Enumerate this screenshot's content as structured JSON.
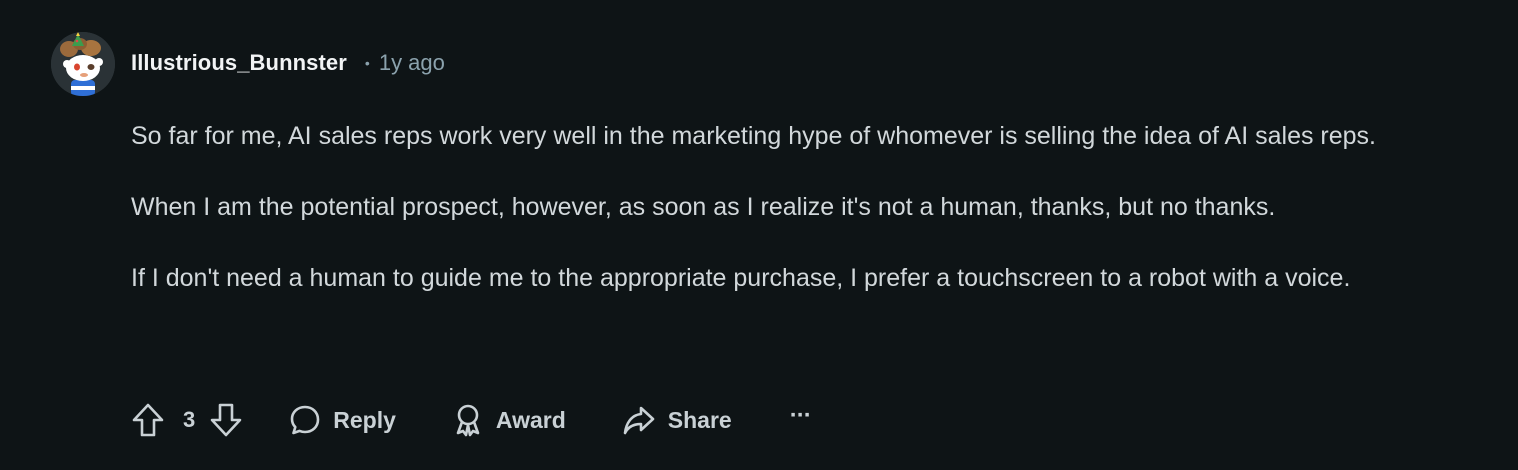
{
  "comment": {
    "author": "Illustrious_Bunnster",
    "separator": "•",
    "time": "1y ago",
    "paragraphs": [
      "So far for me, AI sales reps work very well in the marketing hype of whomever is selling the idea of AI sales reps.",
      "When I am the potential prospect, however, as soon as I realize it's not a human, thanks, but no thanks.",
      "If I don't need a human to guide me to the appropriate purchase, I prefer a touchscreen to a robot with a voice."
    ]
  },
  "actions": {
    "score": "3",
    "reply_label": "Reply",
    "award_label": "Award",
    "share_label": "Share",
    "more_label": "···"
  },
  "icons": {
    "upvote": "upvote-icon",
    "downvote": "downvote-icon",
    "reply": "speech-bubble-icon",
    "award": "award-icon",
    "share": "share-arrow-icon",
    "more": "ellipsis-icon"
  },
  "colors": {
    "background": "#0e1416",
    "username": "#f2f4f5",
    "meta": "#8ba2ad",
    "body_text": "#d2d8db",
    "action_text": "#c9d1d5"
  }
}
